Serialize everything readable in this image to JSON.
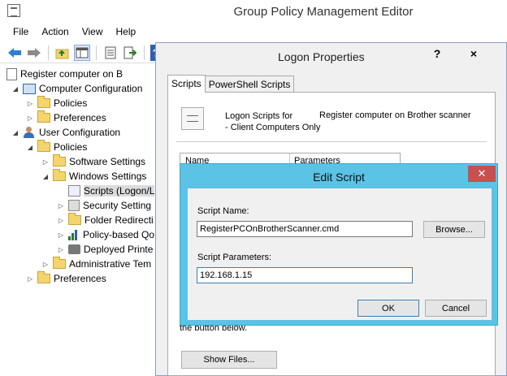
{
  "window": {
    "title": "Group Policy Management Editor"
  },
  "menu": [
    "File",
    "Action",
    "View",
    "Help"
  ],
  "toolbar": {
    "back_icon": "arrow-left-icon",
    "forward_icon": "arrow-right-icon",
    "up_icon": "folder-up-icon",
    "console_icon": "console-tree-icon",
    "properties_icon": "properties-icon",
    "export_icon": "export-icon",
    "help_icon": "help-icon",
    "help_glyph": "?"
  },
  "tree": {
    "root": "Register computer on B",
    "computer_configuration": "Computer Configuration",
    "cc_policies": "Policies",
    "cc_preferences": "Preferences",
    "user_configuration": "User Configuration",
    "uc_policies": "Policies",
    "software_settings": "Software Settings",
    "windows_settings": "Windows Settings",
    "scripts": "Scripts (Logon/L",
    "security_settings": "Security Setting",
    "folder_redirection": "Folder Redirecti",
    "policy_based_qos": "Policy-based Qo",
    "deployed_printers": "Deployed Printe",
    "administrative_templates": "Administrative Tem",
    "uc_preferences": "Preferences"
  },
  "props_dialog": {
    "title": "Logon Properties",
    "help_glyph": "?",
    "close_glyph": "×",
    "tabs": [
      "Scripts",
      "PowerShell Scripts"
    ],
    "desc_line1": "Logon Scripts for",
    "desc_line2": "- Client Computers Only",
    "gpo_name": "Register computer on Brother scanner",
    "col_name": "Name",
    "col_parameters": "Parameters",
    "below_dash": "-",
    "below_text": "the button below.",
    "show_files": "Show Files..."
  },
  "edit_dialog": {
    "title": "Edit Script",
    "close_glyph": "✕",
    "script_name_label": "Script Name:",
    "script_name_value": "RegisterPCOnBrotherScanner.cmd",
    "browse_label": "Browse...",
    "script_params_label": "Script Parameters:",
    "script_params_value": "192.168.1.15",
    "ok_label": "OK",
    "cancel_label": "Cancel"
  }
}
